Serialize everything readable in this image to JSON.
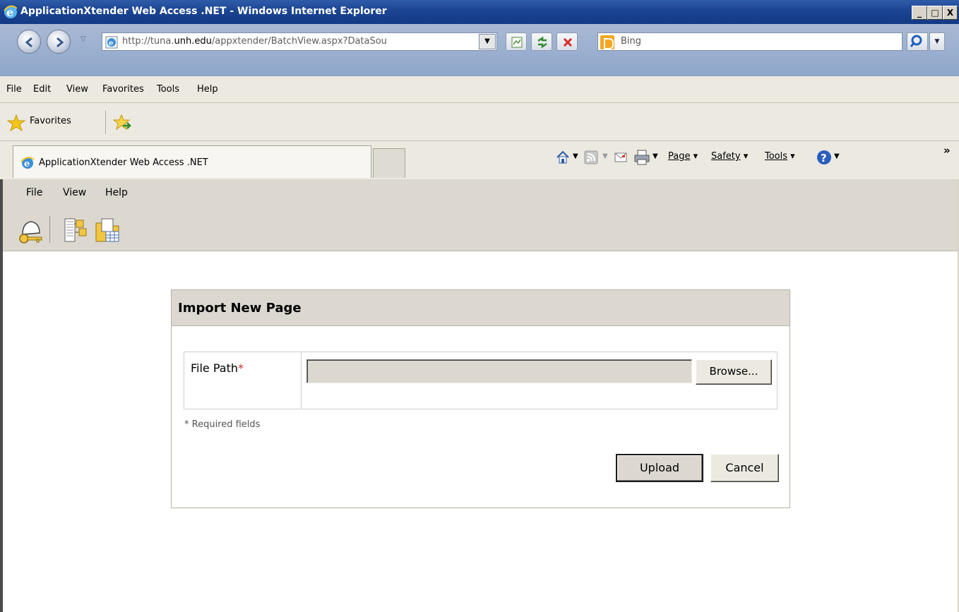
{
  "window": {
    "title": "ApplicationXtender Web Access .NET - Windows Internet Explorer",
    "controls": {
      "minimize": "_",
      "maximize": "□",
      "close": "X"
    }
  },
  "addressbar": {
    "url_prefix": "http://tuna.",
    "url_domain": "unh.edu",
    "url_suffix": "/appxtender/BatchView.aspx?DataSou",
    "search_placeholder": "Bing"
  },
  "menubar": {
    "items": [
      "File",
      "Edit",
      "View",
      "Favorites",
      "Tools",
      "Help"
    ]
  },
  "favorites_bar": {
    "label": "Favorites"
  },
  "tabs": {
    "active_label": "ApplicationXtender Web Access .NET"
  },
  "command_bar": {
    "page": "Page",
    "safety": "Safety",
    "tools": "Tools",
    "overflow": "»"
  },
  "app": {
    "menu": [
      "File",
      "View",
      "Help"
    ]
  },
  "dialog": {
    "title": "Import New Page",
    "field_label": "File Path",
    "required_marker": "*",
    "file_value": "",
    "browse_label": "Browse...",
    "required_note": "* Required fields",
    "upload_label": "Upload",
    "cancel_label": "Cancel"
  },
  "colors": {
    "titlebar": "#1b4492",
    "chrome": "#ece9e0",
    "app_chrome": "#dcd8d0",
    "required": "#d0312d"
  },
  "icons": [
    "ie-logo-icon",
    "back-icon",
    "forward-icon",
    "page-icon",
    "compat-view-icon",
    "refresh-icon",
    "stop-icon",
    "bing-icon",
    "search-icon",
    "star-icon",
    "add-favorite-icon",
    "home-icon",
    "feeds-icon",
    "mail-icon",
    "print-icon",
    "help-icon",
    "login-key-icon",
    "batch-tree-icon",
    "document-grid-icon"
  ]
}
